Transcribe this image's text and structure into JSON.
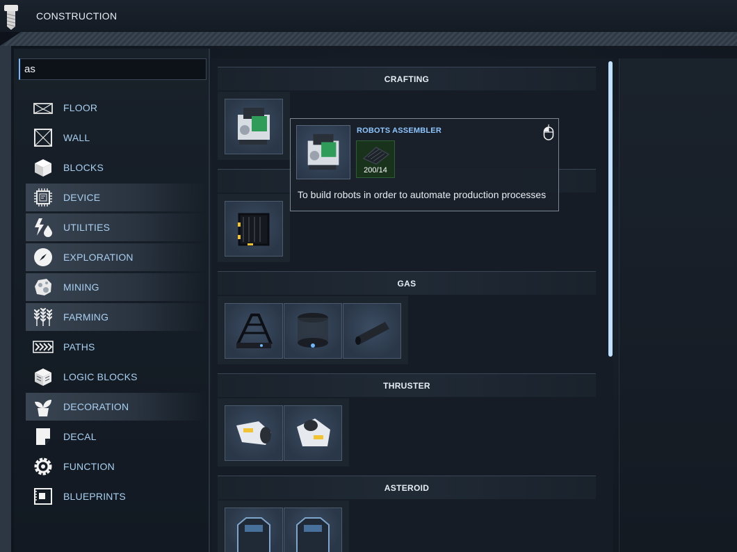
{
  "header": {
    "title": "CONSTRUCTION"
  },
  "search": {
    "value": "as"
  },
  "categories": [
    {
      "label": "FLOOR",
      "icon": "floor-icon",
      "highlighted": false
    },
    {
      "label": "WALL",
      "icon": "wall-icon",
      "highlighted": false
    },
    {
      "label": "BLOCKS",
      "icon": "blocks-icon",
      "highlighted": false
    },
    {
      "label": "DEVICE",
      "icon": "device-chip-icon",
      "highlighted": true
    },
    {
      "label": "UTILITIES",
      "icon": "utilities-bolt-drop-icon",
      "highlighted": true
    },
    {
      "label": "EXPLORATION",
      "icon": "compass-icon",
      "highlighted": true
    },
    {
      "label": "MINING",
      "icon": "asteroid-icon",
      "highlighted": true
    },
    {
      "label": "FARMING",
      "icon": "wheat-icon",
      "highlighted": true
    },
    {
      "label": "PATHS",
      "icon": "chevrons-icon",
      "highlighted": false
    },
    {
      "label": "LOGIC BLOCKS",
      "icon": "logic-cube-icon",
      "highlighted": false
    },
    {
      "label": "DECORATION",
      "icon": "plant-icon",
      "highlighted": true
    },
    {
      "label": "DECAL",
      "icon": "decal-icon",
      "highlighted": false
    },
    {
      "label": "FUNCTION",
      "icon": "gear-icon",
      "highlighted": false
    },
    {
      "label": "BLUEPRINTS",
      "icon": "blueprint-icon",
      "highlighted": false
    }
  ],
  "sections": [
    {
      "title": "CRAFTING",
      "items": [
        "robots-assembler"
      ]
    },
    {
      "title": "",
      "items": [
        "cage-frame"
      ]
    },
    {
      "title": "GAS",
      "items": [
        "gas-derrick",
        "gas-tank",
        "gas-pipe"
      ]
    },
    {
      "title": "THRUSTER",
      "items": [
        "thruster-small",
        "thruster-large"
      ]
    },
    {
      "title": "ASTEROID",
      "items": [
        "asteroid-module-1",
        "asteroid-module-2"
      ]
    }
  ],
  "tooltip": {
    "name": "ROBOTS ASSEMBLER",
    "resource_count": "200/14",
    "description": "To build robots in order to automate production processes"
  },
  "colors": {
    "accent": "#8ec6ff",
    "label": "#a9d0f0",
    "background": "#0e131b",
    "scrollbar": "#bfe0ff"
  }
}
